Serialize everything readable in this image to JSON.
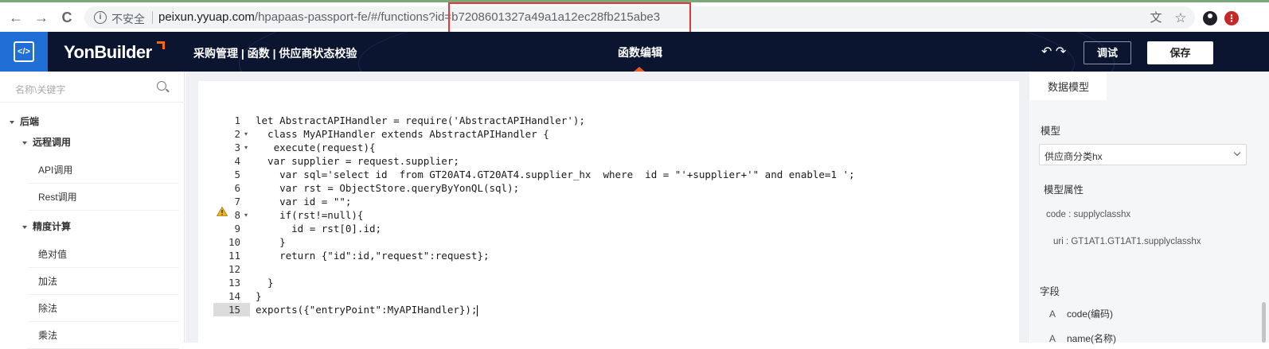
{
  "browser": {
    "insecure_label": "不安全",
    "url_host": "peixun.yyuap.com",
    "url_path": "/hpapaas-passport-fe/#/functions?id",
    "url_id": "=b7208601327a49a1a12ec28fb215abe3"
  },
  "header": {
    "brand": "YonBuilder",
    "breadcrumb": "采购管理 | 函数 | 供应商状态校验",
    "center_title": "函数编辑",
    "debug_label": "调试",
    "save_label": "保存",
    "undo_redo": "↶ ↷"
  },
  "sidebar": {
    "search_placeholder": "名称\\关键字",
    "root": "后端",
    "groups": [
      {
        "label": "远程调用",
        "items": [
          "API调用",
          "Rest调用"
        ]
      },
      {
        "label": "精度计算",
        "items": [
          "绝对值",
          "加法",
          "除法",
          "乘法"
        ]
      }
    ]
  },
  "editor": {
    "line_numbers": [
      "1",
      "2",
      "3",
      "4",
      "5",
      "6",
      "7",
      "8",
      "9",
      "10",
      "11",
      "12",
      "13",
      "14",
      "15"
    ],
    "lines": [
      "let AbstractAPIHandler = require('AbstractAPIHandler');",
      "  class MyAPIHandler extends AbstractAPIHandler {",
      "   execute(request){",
      "  var supplier = request.supplier;",
      "    var sql='select id  from GT20AT4.GT20AT4.supplier_hx  where  id = \"'+supplier+'\" and enable=1 ';",
      "    var rst = ObjectStore.queryByYonQL(sql);",
      "    var id = \"\";",
      "    if(rst!=null){",
      "      id = rst[0].id;",
      "    }",
      "    return {\"id\":id,\"request\":request};",
      "",
      "  }",
      "}",
      "exports({\"entryPoint\":MyAPIHandler});"
    ]
  },
  "right_panel": {
    "tab_label": "数据模型",
    "model_label": "模型",
    "model_value": "供应商分类hx",
    "model_props_label": "模型属性",
    "code_meta": "code : supplyclasshx",
    "uri_meta": "uri :  GT1AT1.GT1AT1.supplyclasshx",
    "fields_label": "字段",
    "fields": [
      {
        "icon": "A",
        "label": "code(编码)"
      },
      {
        "icon": "A",
        "label": "name(名称)"
      }
    ]
  }
}
